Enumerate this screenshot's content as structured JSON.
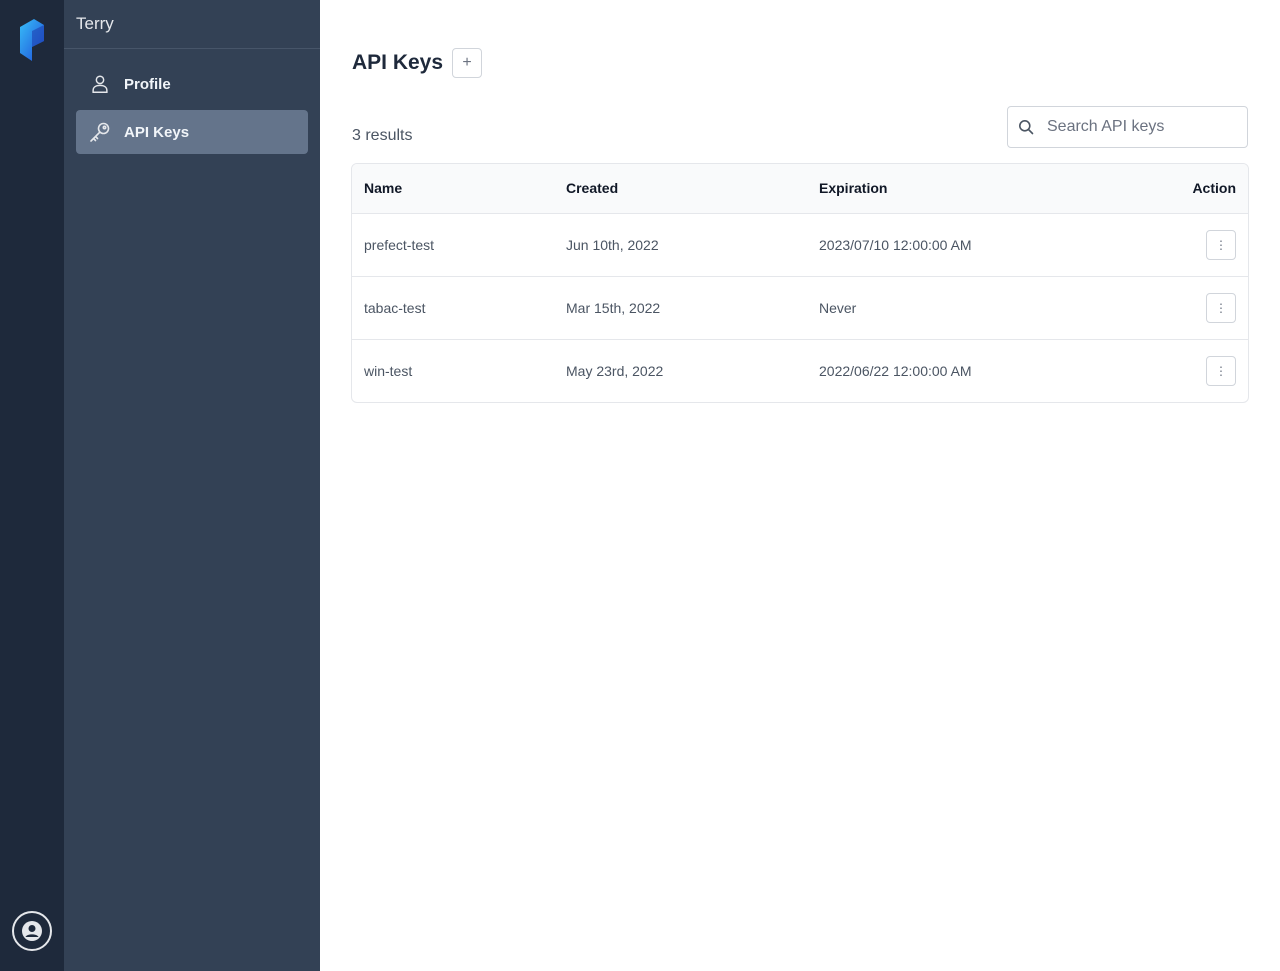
{
  "app": {
    "accent": "#0ea5e9"
  },
  "sidebar": {
    "user_name": "Terry",
    "items": [
      {
        "label": "Profile",
        "icon": "user-icon",
        "active": false
      },
      {
        "label": "API Keys",
        "icon": "key-icon",
        "active": true
      }
    ]
  },
  "page": {
    "title": "API Keys",
    "add_label": "+",
    "results_count": "3 results",
    "search_placeholder": "Search API keys"
  },
  "table": {
    "headers": {
      "name": "Name",
      "created": "Created",
      "expiration": "Expiration",
      "action": "Action"
    },
    "rows": [
      {
        "name": "prefect-test",
        "created": "Jun 10th, 2022",
        "expiration": "2023/07/10 12:00:00 AM"
      },
      {
        "name": "tabac-test",
        "created": "Mar 15th, 2022",
        "expiration": "Never"
      },
      {
        "name": "win-test",
        "created": "May 23rd, 2022",
        "expiration": "2022/06/22 12:00:00 AM"
      }
    ],
    "row_menu_glyph": "⋮"
  }
}
